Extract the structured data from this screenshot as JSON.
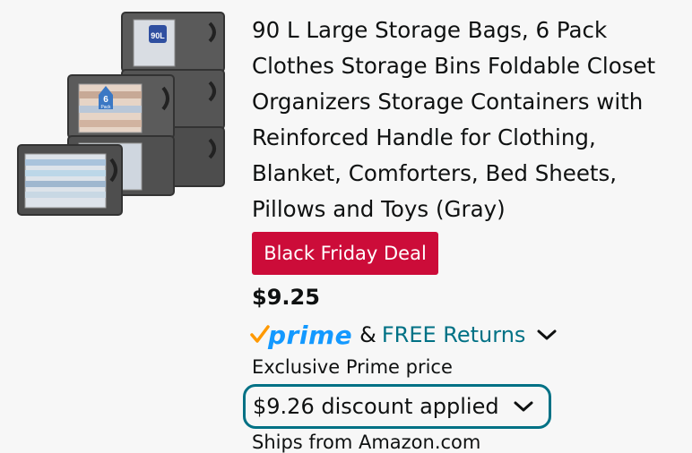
{
  "product": {
    "title": "90 L Large Storage Bags, 6 Pack Clothes Storage Bins Foldable Closet Organizers Storage Containers with Reinforced Handle for Clothing, Blanket, Comforters, Bed Sheets, Pillows and Toys (Gray)",
    "image": {
      "capacity_label": "90L",
      "pack_label_number": "6",
      "pack_label_word": "Pack"
    },
    "deal_badge": "Black Friday Deal",
    "price": "$9.25",
    "prime": {
      "logo_text": "prime",
      "separator": "&",
      "free_returns": "FREE Returns"
    },
    "exclusive_price_label": "Exclusive Prime price",
    "discount_label": "$9.26 discount applied",
    "ships_from": "Ships from Amazon.com"
  },
  "colors": {
    "deal_red": "#cc0c39",
    "prime_blue": "#1399ff",
    "prime_check": "#ff9900",
    "link_teal": "#007185"
  },
  "icons": [
    "chevron-down-icon",
    "prime-check-icon"
  ]
}
